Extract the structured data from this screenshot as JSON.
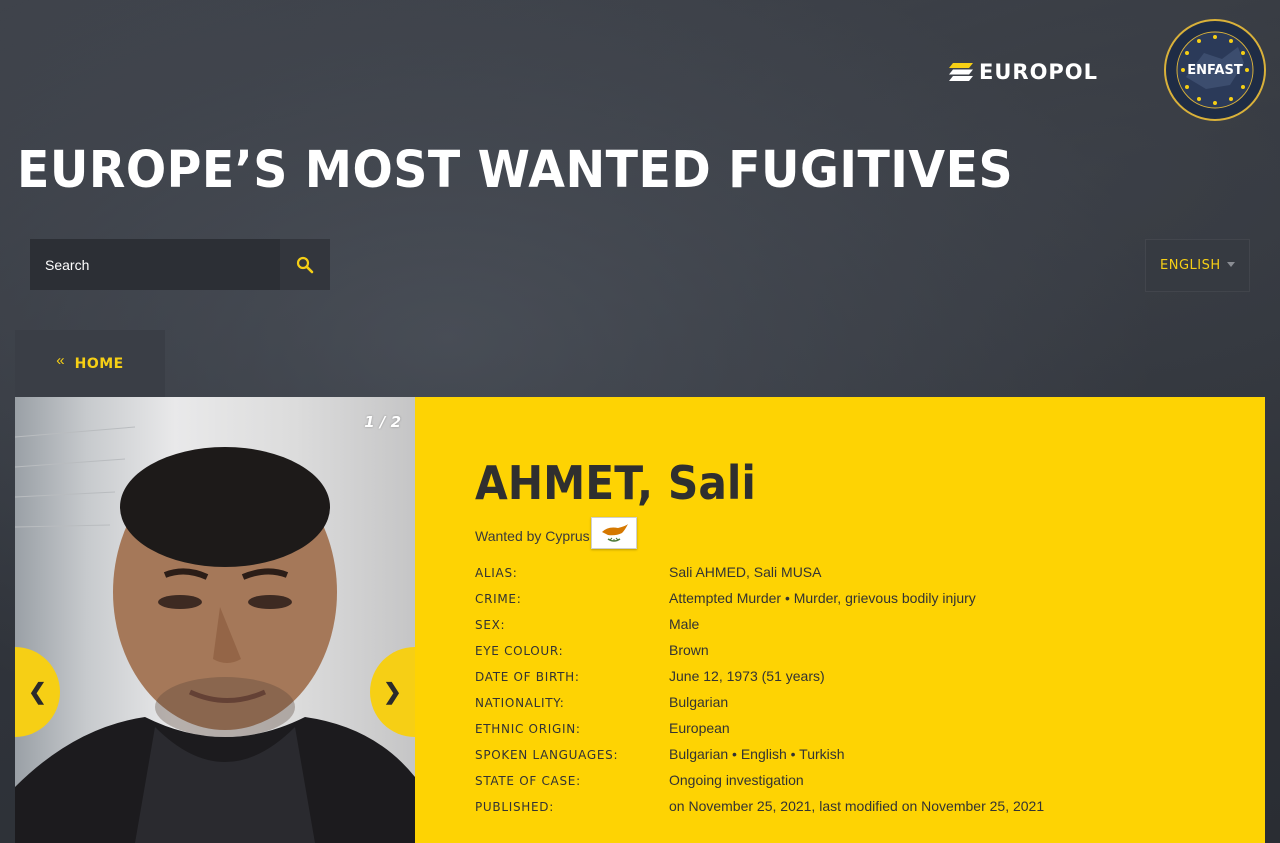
{
  "header": {
    "europol_logo_text": "EUROPOL",
    "enfast_badge_text": "ENFAST",
    "title": "EUROPE’S MOST WANTED FUGITIVES"
  },
  "search": {
    "placeholder": "Search"
  },
  "language": {
    "selected": "ENGLISH"
  },
  "nav": {
    "home_chevron": "«",
    "home_label": "HOME"
  },
  "photo": {
    "counter": "1 / 2",
    "prev_icon": "❮",
    "next_icon": "❯"
  },
  "fugitive": {
    "name": "AHMET, Sali",
    "wanted_by": "Wanted by Cyprus",
    "flag_icon": "cyprus-flag-icon",
    "details": [
      {
        "label": "ALIAS:",
        "value": "Sali AHMED, Sali MUSA"
      },
      {
        "label": "CRIME:",
        "value": "Attempted Murder • Murder, grievous bodily injury"
      },
      {
        "label": "SEX:",
        "value": "Male"
      },
      {
        "label": "EYE COLOUR:",
        "value": "Brown"
      },
      {
        "label": "DATE OF BIRTH:",
        "value": "June 12, 1973 (51 years)"
      },
      {
        "label": "NATIONALITY:",
        "value": "Bulgarian"
      },
      {
        "label": "ETHNIC ORIGIN:",
        "value": "European"
      },
      {
        "label": "SPOKEN LANGUAGES:",
        "value": "Bulgarian • English • Turkish"
      },
      {
        "label": "STATE OF CASE:",
        "value": "Ongoing investigation"
      },
      {
        "label": "PUBLISHED:",
        "value": "on November 25, 2021, last modified on November 25, 2021"
      }
    ]
  },
  "colors": {
    "accent_yellow": "#fed303",
    "label_yellow": "#f6cf15",
    "background_dark": "#30343b"
  }
}
